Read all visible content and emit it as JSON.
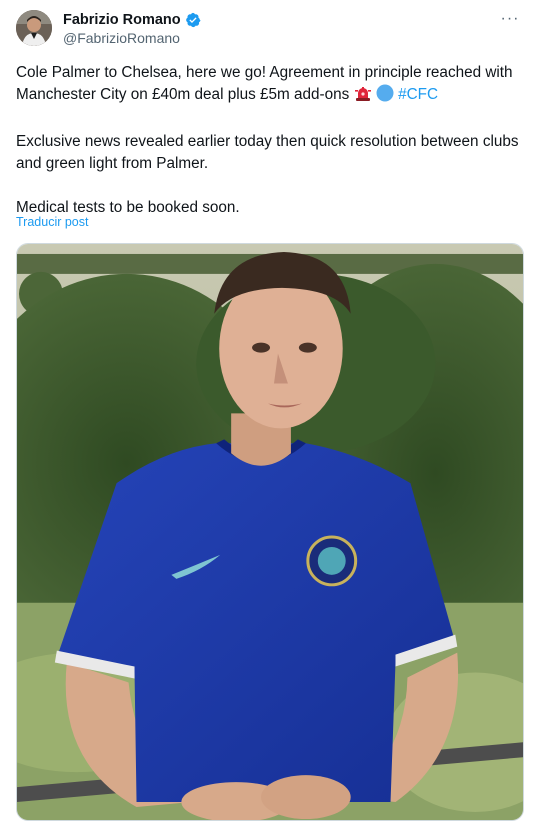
{
  "author": {
    "name": "Fabrizio Romano",
    "handle": "@FabrizioRomano",
    "verified": true
  },
  "menu": {
    "icon": "more-horizontal-icon",
    "label": "···"
  },
  "post": {
    "line1": "Cole Palmer to Chelsea, here we go! Agreement in principle reached with Manchester City on £40m deal plus £5m add-ons ",
    "hashtag": "#CFC",
    "line2": "Exclusive news revealed earlier today then quick resolution between clubs and green light from Palmer.",
    "line3": "Medical tests to be booked soon.",
    "emojis": [
      "rotating-light-icon",
      "blue-circle-icon"
    ]
  },
  "translate_label": "Traducir post",
  "media": {
    "description_icon": "photo-image",
    "colors": {
      "shirt": "#1f3aa8",
      "background_trees": "#3f5a2e"
    }
  },
  "colors": {
    "accent": "#1d9bf0",
    "secondary_text": "#536471"
  }
}
